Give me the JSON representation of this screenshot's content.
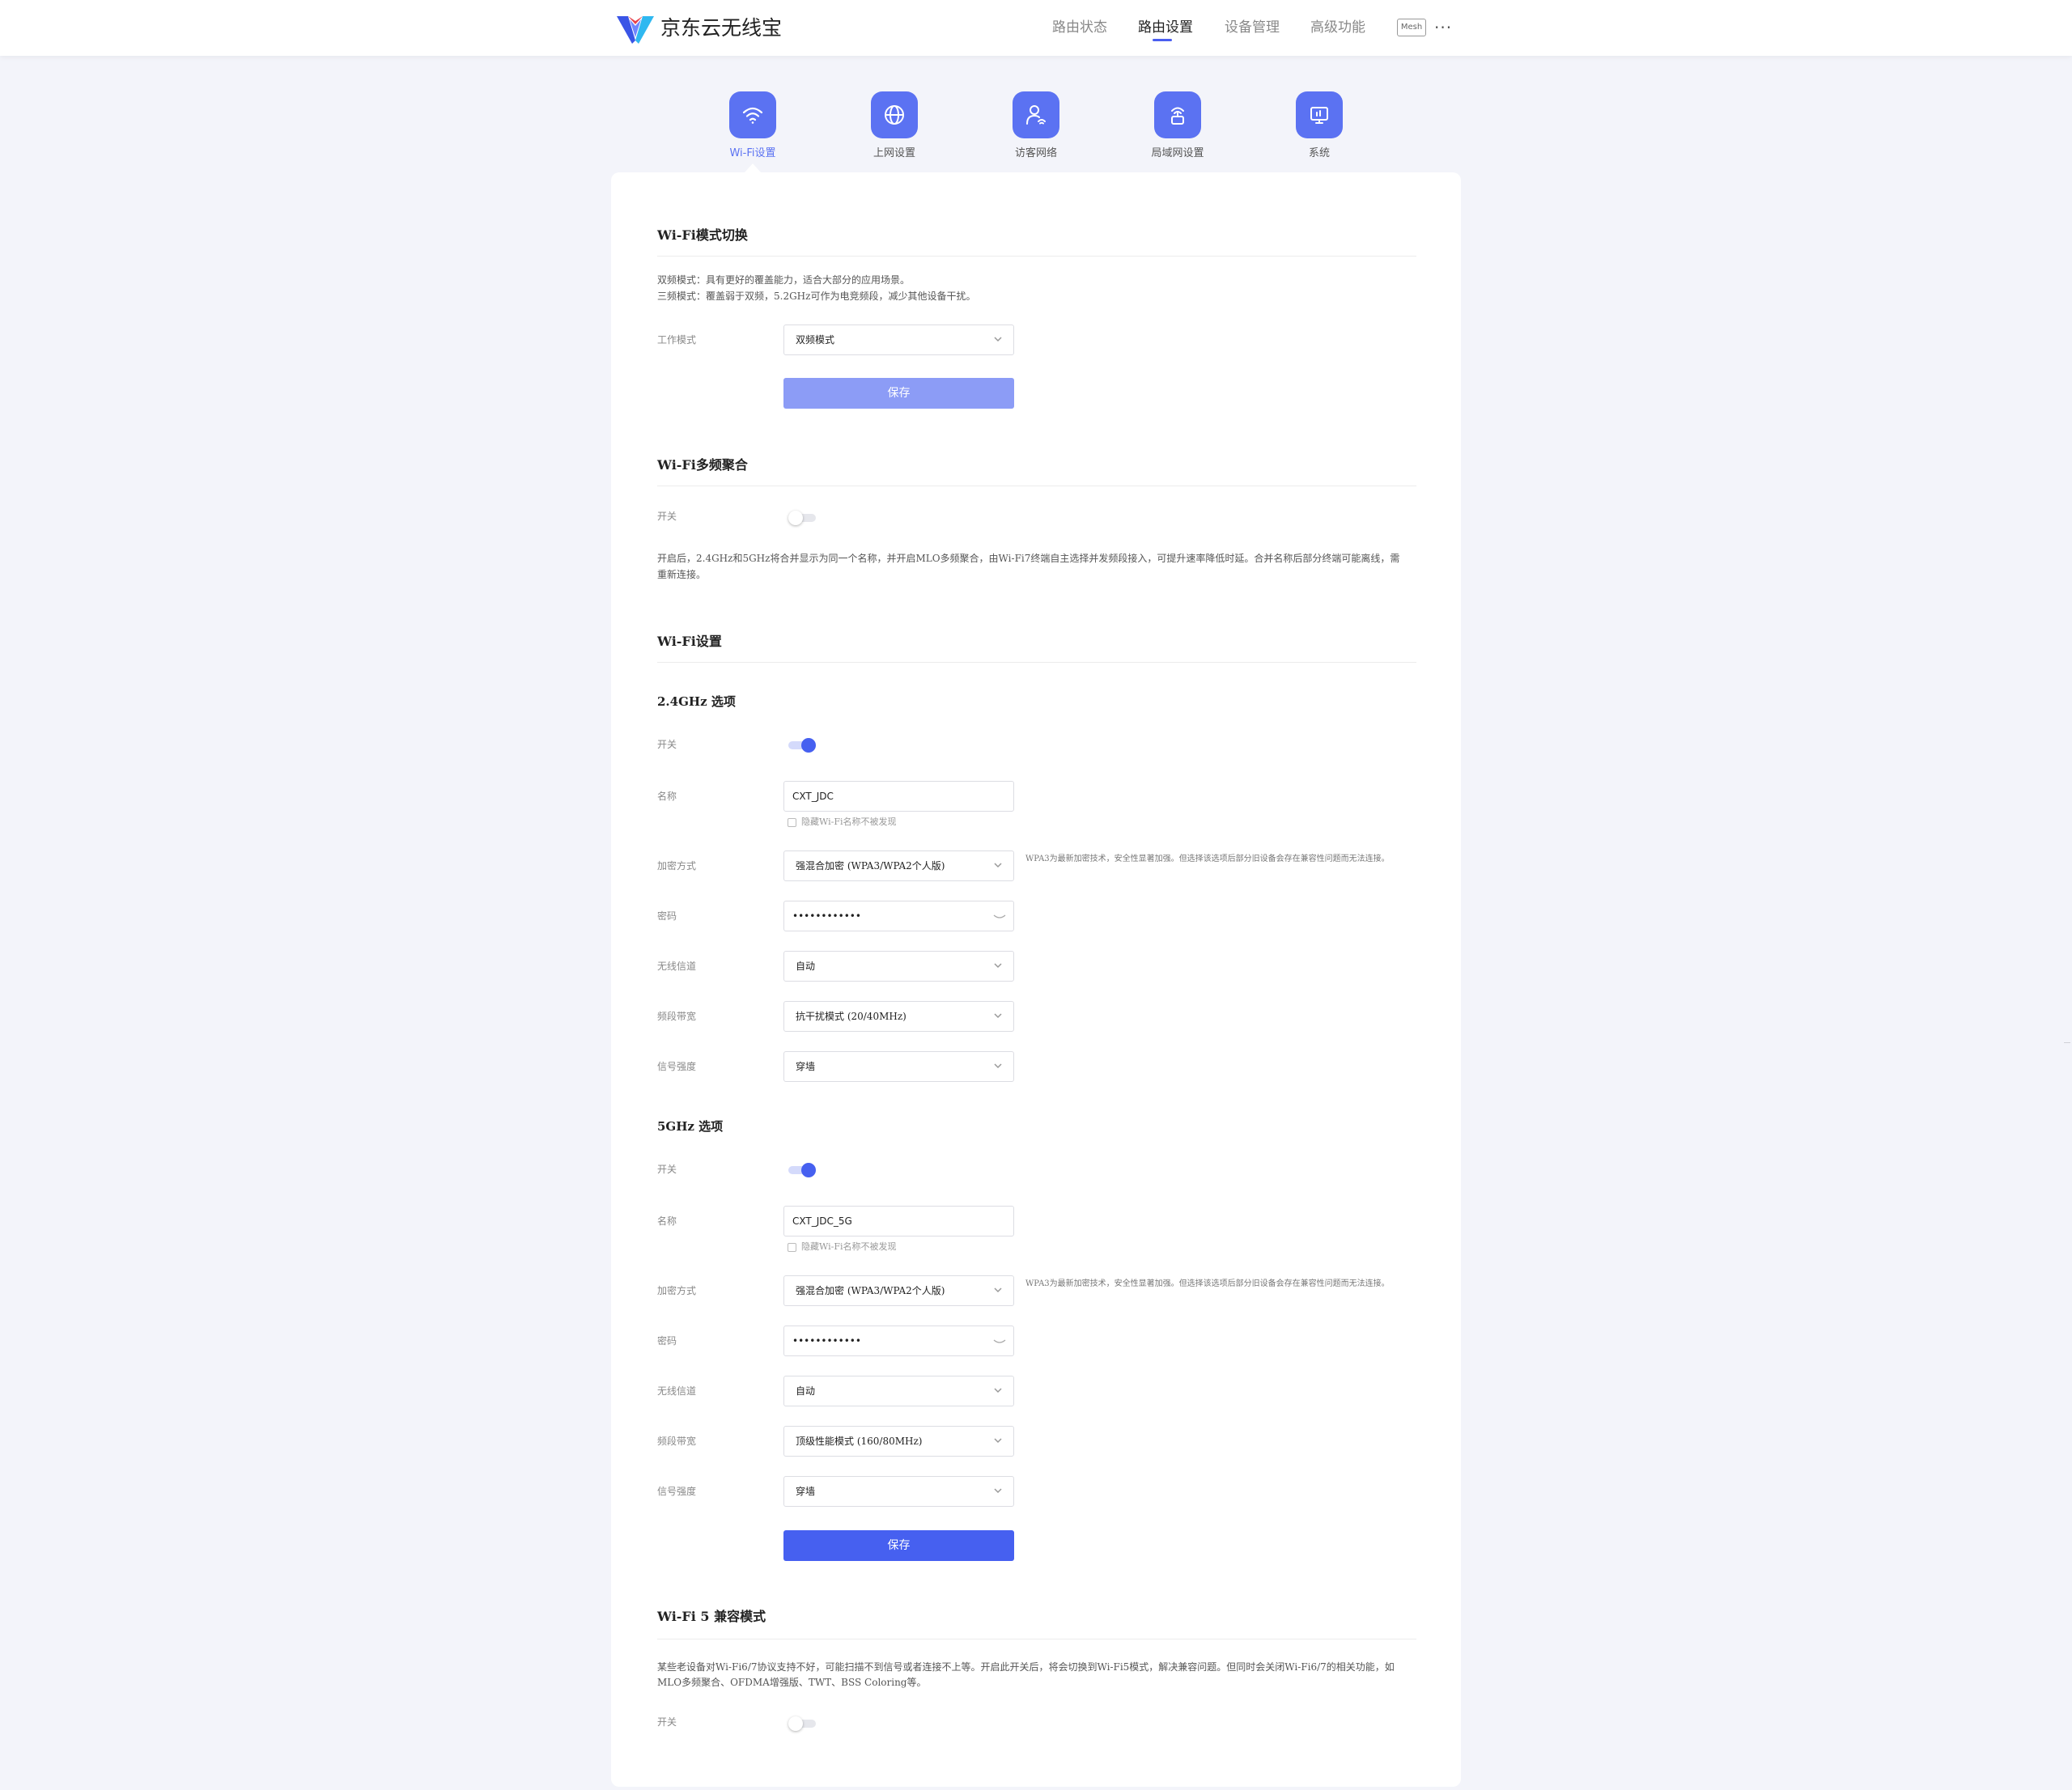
{
  "header": {
    "brand": "京东云无线宝",
    "nav": [
      "路由状态",
      "路由设置",
      "设备管理",
      "高级功能"
    ],
    "active_nav": "路由设置",
    "mesh_badge": "Mesh",
    "more": "···",
    "colors": {
      "accent": "#4660f0",
      "tile": "#5b72f2"
    }
  },
  "tiles": [
    {
      "label": "Wi-Fi设置",
      "icon": "wifi-icon",
      "active": true
    },
    {
      "label": "上网设置",
      "icon": "globe-icon"
    },
    {
      "label": "访客网络",
      "icon": "guest-user-icon"
    },
    {
      "label": "局域网设置",
      "icon": "lan-router-icon"
    },
    {
      "label": "系统",
      "icon": "system-monitor-icon"
    }
  ],
  "mode_section": {
    "title": "Wi-Fi模式切换",
    "desc1": "双频模式：具有更好的覆盖能力，适合大部分的应用场景。",
    "desc2": "三频模式：覆盖弱于双频，5.2GHz可作为电竞频段，减少其他设备干扰。",
    "work_mode_label": "工作模式",
    "work_mode_value": "双频模式",
    "save_label": "保存"
  },
  "mlo_section": {
    "title": "Wi-Fi多频聚合",
    "switch_label": "开关",
    "switch_on": false,
    "desc": "开启后，2.4GHz和5GHz将合并显示为同一个名称，并开启MLO多频聚合，由Wi-Fi7终端自主选择并发频段接入，可提升速率降低时延。合并名称后部分终端可能离线，需",
    "desc2": "重新连接。"
  },
  "wifi_section": {
    "title": "Wi-Fi设置",
    "save_label": "保存",
    "band24": {
      "title": "2.4GHz 选项",
      "switch_label": "开关",
      "switch_on": true,
      "name_label": "名称",
      "name_value": "CXT_JDC",
      "hide_label": "隐藏Wi-Fi名称不被发现",
      "enc_label": "加密方式",
      "enc_value": "强混合加密 (WPA3/WPA2个人版)",
      "enc_note": "WPA3为最新加密技术，安全性显著加强。但选择该选项后部分旧设备会存在兼容性问题而无法连接。",
      "pwd_label": "密码",
      "pwd_value": "••••••••••••",
      "channel_label": "无线信道",
      "channel_value": "自动",
      "bw_label": "频段带宽",
      "bw_value": "抗干扰模式 (20/40MHz)",
      "signal_label": "信号强度",
      "signal_value": "穿墙"
    },
    "band5": {
      "title": "5GHz 选项",
      "switch_label": "开关",
      "switch_on": true,
      "name_label": "名称",
      "name_value": "CXT_JDC_5G",
      "hide_label": "隐藏Wi-Fi名称不被发现",
      "enc_label": "加密方式",
      "enc_value": "强混合加密 (WPA3/WPA2个人版)",
      "enc_note": "WPA3为最新加密技术，安全性显著加强。但选择该选项后部分旧设备会存在兼容性问题而无法连接。",
      "pwd_label": "密码",
      "pwd_value": "••••••••••••",
      "channel_label": "无线信道",
      "channel_value": "自动",
      "bw_label": "频段带宽",
      "bw_value": "顶级性能模式 (160/80MHz)",
      "signal_label": "信号强度",
      "signal_value": "穿墙"
    }
  },
  "wifi5_section": {
    "title": "Wi-Fi 5 兼容模式",
    "desc": "某些老设备对Wi-Fi6/7协议支持不好，可能扫描不到信号或者连接不上等。开启此开关后，将会切换到Wi-Fi5模式，解决兼容问题。但同时会关闭Wi-Fi6/7的相关功能，如",
    "desc2": "MLO多频聚合、OFDMA增强版、TWT、BSS Coloring等。",
    "switch_label": "开关",
    "switch_on": false
  }
}
